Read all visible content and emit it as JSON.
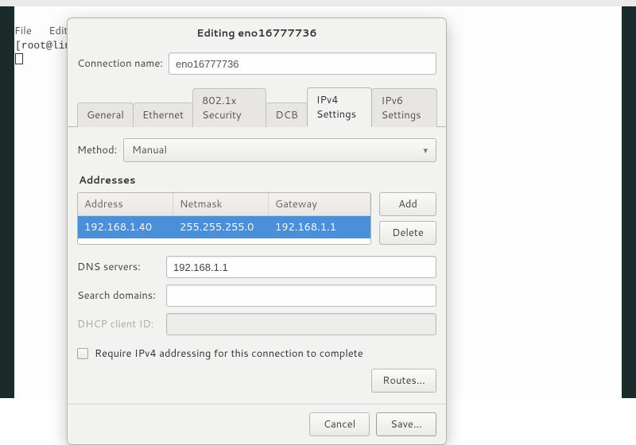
{
  "terminal": {
    "menu_file": "File",
    "menu_edit": "Edit",
    "prompt": "[root@lin"
  },
  "dialog": {
    "title": "Editing eno16777736",
    "conn_name_label": "Connection name:",
    "conn_name_value": "eno16777736",
    "tabs": {
      "general": "General",
      "ethernet": "Ethernet",
      "security": "802.1x Security",
      "dcb": "DCB",
      "ipv4": "IPv4 Settings",
      "ipv6": "IPv6 Settings"
    },
    "method_label": "Method:",
    "method_value": "Manual",
    "addresses_label": "Addresses",
    "addr_headers": {
      "address": "Address",
      "netmask": "Netmask",
      "gateway": "Gateway"
    },
    "addr_row": {
      "address": "192.168.1.40",
      "netmask": "255.255.255.0",
      "gateway": "192.168.1.1"
    },
    "add_label": "Add",
    "delete_label": "Delete",
    "dns_label": "DNS servers:",
    "dns_value": "192.168.1.1",
    "search_label": "Search domains:",
    "search_value": "",
    "dhcp_label": "DHCP client ID:",
    "dhcp_value": "",
    "require_label": "Require IPv4 addressing for this connection to complete",
    "routes_label": "Routes...",
    "cancel_label": "Cancel",
    "save_label": "Save..."
  }
}
